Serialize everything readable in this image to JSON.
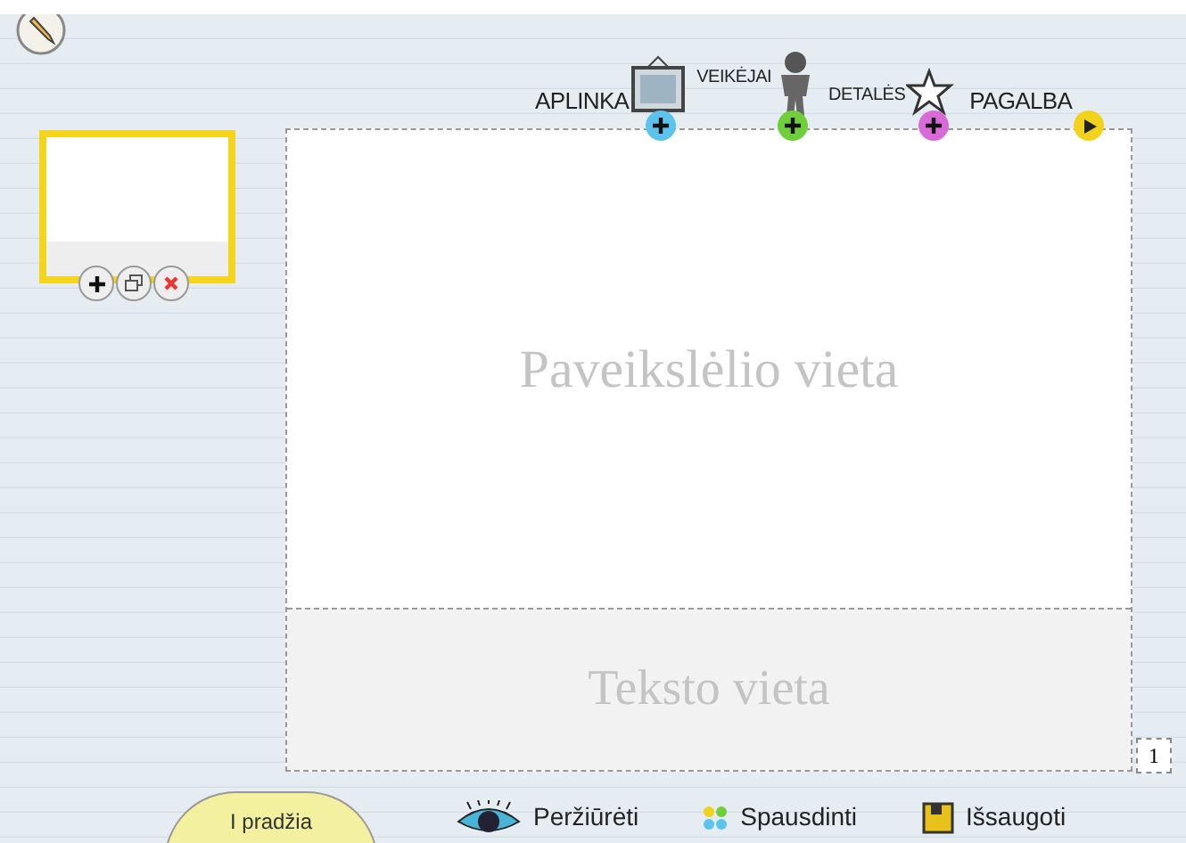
{
  "nav": [
    {
      "label": "APLINKA",
      "kind": "scene",
      "color": "#5bc3ec"
    },
    {
      "label": "VEIKĖJAI",
      "kind": "character",
      "color": "#6fcf3a"
    },
    {
      "label": "DETALĖS",
      "kind": "detail",
      "color": "#d86ad8"
    },
    {
      "label": "PAGALBA",
      "kind": "help",
      "color": "#f2d21a"
    }
  ],
  "slides": [
    {
      "selected": true
    }
  ],
  "page": {
    "picture_placeholder": "Paveikslėlio vieta",
    "text_placeholder": "Teksto vieta",
    "page_number": "1"
  },
  "actions": [
    {
      "label": "Peržiūrėti",
      "kind": "preview"
    },
    {
      "label": "Spausdinti",
      "kind": "print"
    },
    {
      "label": "Išsaugoti",
      "kind": "save"
    }
  ],
  "home_button": "I pradžia"
}
